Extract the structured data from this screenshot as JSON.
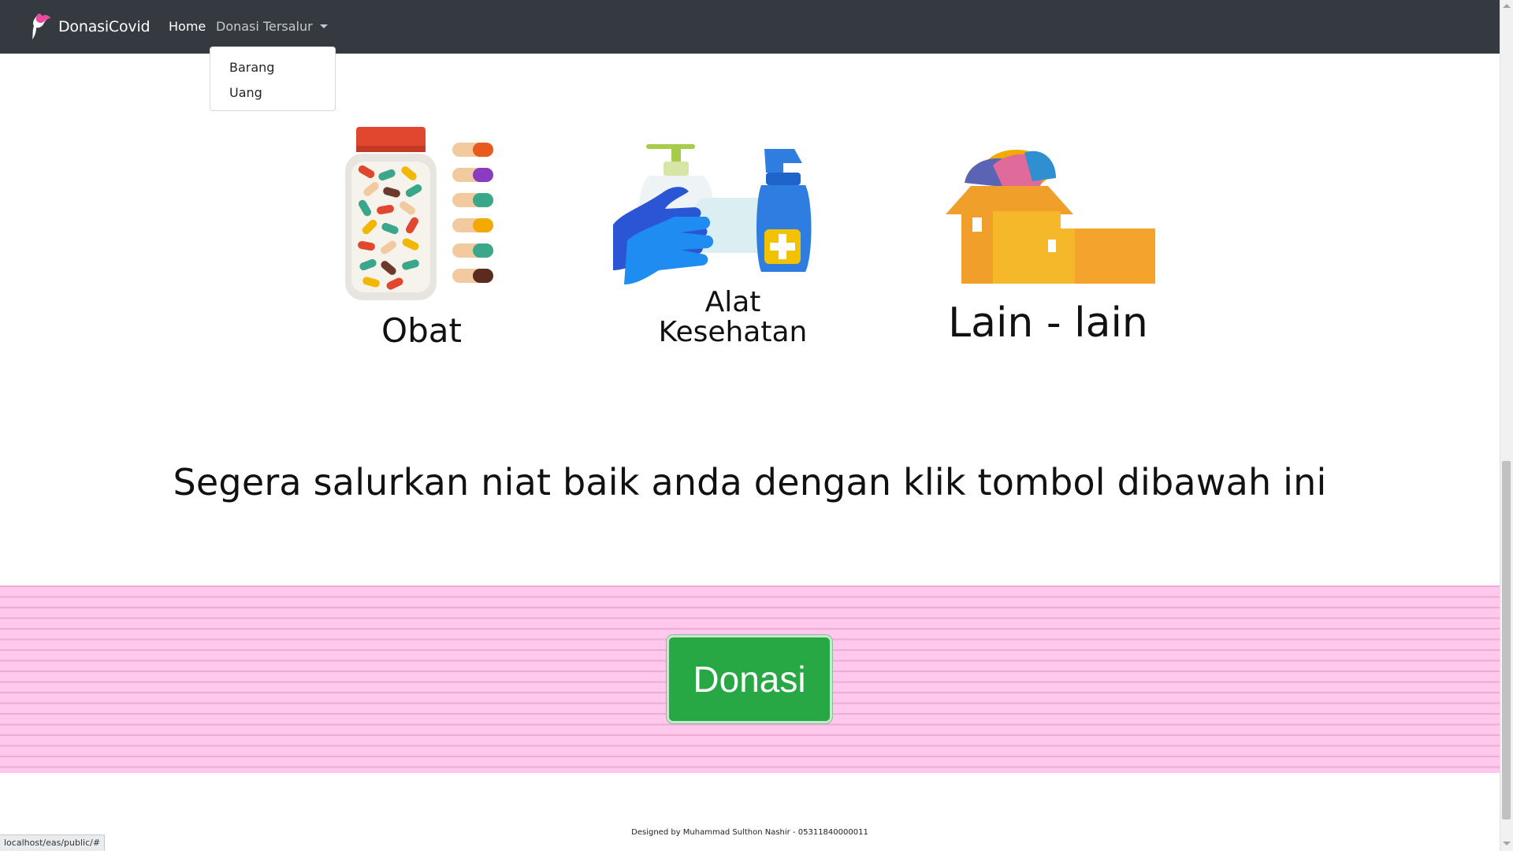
{
  "navbar": {
    "brand": "DonasiCovid",
    "home_label": "Home",
    "donasi_label": "Donasi Tersalur",
    "dropdown_items": [
      "Barang",
      "Uang"
    ]
  },
  "categories": [
    {
      "label": "Obat",
      "icon": "medicine-bottle-icon"
    },
    {
      "label_line1": "Alat",
      "label_line2": "Kesehatan",
      "icon": "health-tools-icon"
    },
    {
      "label": "Lain - lain",
      "icon": "boxes-icon"
    }
  ],
  "cta_text": "Segera salurkan niat baik anda dengan klik tombol dibawah ini",
  "donasi_button": "Donasi",
  "footer": "Designed by Muhammad Sulthon Nashir - 05311840000011",
  "status_url": "localhost/eas/public/#",
  "colors": {
    "navbar": "#343a40",
    "button": "#28a745",
    "pink_band": "#ffc8ec"
  }
}
